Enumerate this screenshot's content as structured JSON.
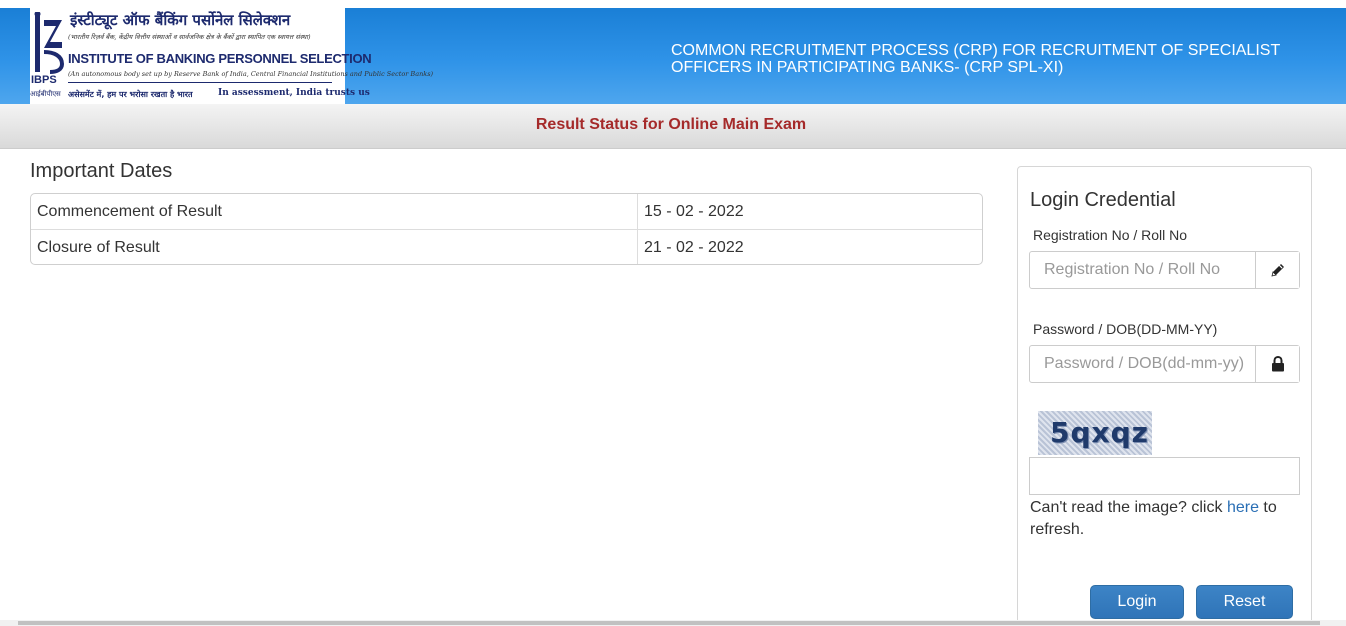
{
  "header": {
    "logo": {
      "hindi_name": "इंस्टीट्यूट ऑफ बैंकिंग पर्सोनेल सिलेक्शन",
      "hindi_sub": "(भारतीय रिज़र्व बैंक, केंद्रीय वित्तीय संस्थाओं व सार्वजनिक क्षेत्र के बैंकों द्वारा स्थापित एक स्वायत्त संस्था)",
      "english_name": "INSTITUTE OF BANKING PERSONNEL SELECTION",
      "english_sub": "(An autonomous body set up by Reserve Bank of India, Central Financial Institutions and Public Sector Banks)",
      "tagline_hindi": "असेसमेंट में, हम पर भरोसा रखता है भारत",
      "tagline_english": "In assessment, India trusts us",
      "abbr": "IBPS",
      "abbr_hindi": "आईबीपीएस"
    },
    "title": "COMMON RECRUITMENT PROCESS (CRP) FOR RECRUITMENT OF SPECIALIST OFFICERS IN PARTICIPATING BANKS- (CRP SPL-XI)"
  },
  "subbar": {
    "title": "Result Status for Online Main Exam"
  },
  "important_dates": {
    "title": "Important Dates",
    "rows": [
      {
        "label": "Commencement of Result",
        "value": "15 - 02 - 2022"
      },
      {
        "label": "Closure of Result",
        "value": "21 - 02 - 2022"
      }
    ]
  },
  "login": {
    "title": "Login Credential",
    "registration_label": "Registration No / Roll No",
    "registration_placeholder": "Registration No / Roll No",
    "registration_value": "",
    "password_label": "Password / DOB(DD-MM-YY)",
    "password_placeholder": "Password / DOB(dd-mm-yy)",
    "password_value": "",
    "captcha_text": "5qxqz",
    "captcha_value": "",
    "refresh_prefix": "Can't read the image? click ",
    "refresh_link": "here",
    "refresh_suffix": " to refresh.",
    "login_button": "Login",
    "reset_button": "Reset",
    "icons": {
      "registration": "pencil-icon",
      "password": "lock-icon"
    }
  },
  "colors": {
    "header_blue": "#2f93e8",
    "subbar_title": "#a52a2a",
    "button_blue": "#337ab7",
    "link_blue": "#2a6fb5"
  }
}
